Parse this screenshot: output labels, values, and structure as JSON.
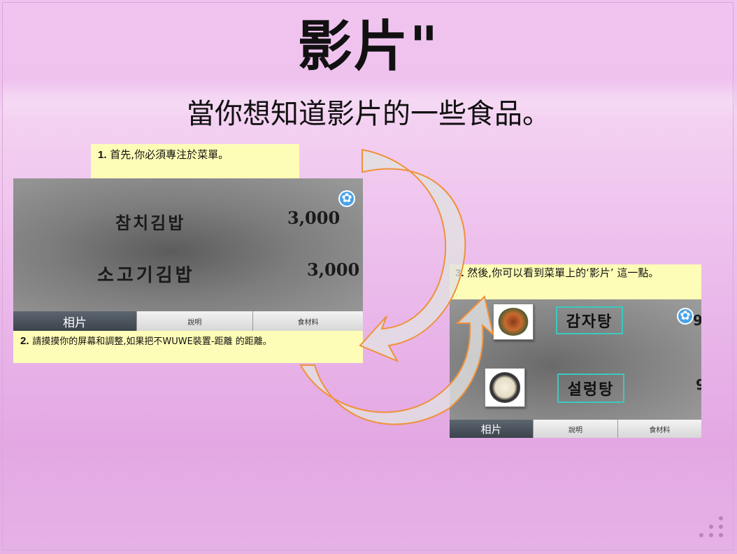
{
  "slide": {
    "title": "影片\"",
    "subtitle": "當你想知道影片的一些食品。"
  },
  "steps": [
    {
      "num": "1.",
      "text": "首先,你必須專注於菜單。"
    },
    {
      "num": "2.",
      "text": "請摸摸你的屏幕和調整,如果把不WUWE裝置-距離  的距離。"
    },
    {
      "num": "3.",
      "text": "然後,你可以看到菜單上的‘影片’ 這一點。"
    }
  ],
  "screen1": {
    "menu": [
      {
        "name": "참치김밥",
        "price": "3,000"
      },
      {
        "name": "소고기김밥",
        "price": "3,000"
      }
    ],
    "tabs": [
      "相片",
      "說明",
      "食材料"
    ]
  },
  "screen2": {
    "items": [
      "감자탕",
      "설렁탕"
    ],
    "edge_digits": [
      "9",
      "9"
    ],
    "tabs": [
      "相片",
      "說明",
      "食材料"
    ]
  },
  "colors": {
    "note_bg": "#fefdb7",
    "arrow_stroke": "#f0913a",
    "accent": "#4aa3e8"
  }
}
